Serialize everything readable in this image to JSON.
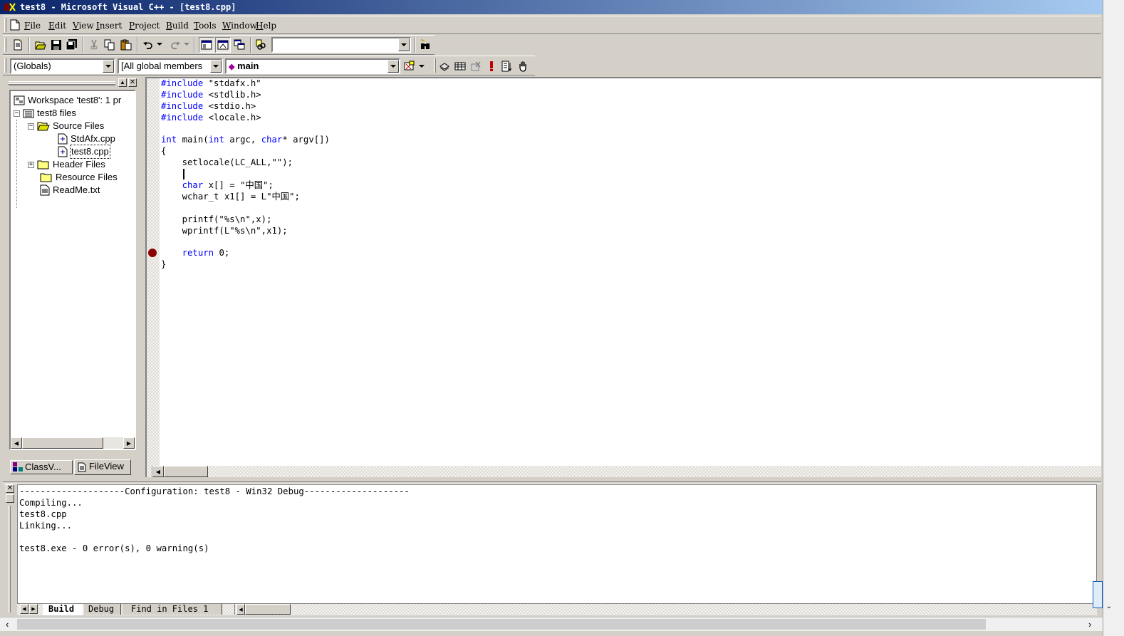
{
  "window": {
    "title": "test8 - Microsoft Visual C++ - [test8.cpp]"
  },
  "menu": {
    "items": [
      {
        "label": "File",
        "mnemonic": "F",
        "rest": "ile"
      },
      {
        "label": "Edit",
        "mnemonic": "E",
        "rest": "dit"
      },
      {
        "label": "View",
        "mnemonic": "V",
        "rest": "iew"
      },
      {
        "label": "Insert",
        "mnemonic": "I",
        "rest": "nsert"
      },
      {
        "label": "Project",
        "mnemonic": "P",
        "rest": "roject"
      },
      {
        "label": "Build",
        "mnemonic": "B",
        "rest": "uild"
      },
      {
        "label": "Tools",
        "mnemonic": "T",
        "rest": "ools"
      },
      {
        "label": "Window",
        "mnemonic": "W",
        "rest": "indow"
      },
      {
        "label": "Help",
        "mnemonic": "H",
        "rest": "elp"
      }
    ]
  },
  "toolbar": {
    "find_combo_value": ""
  },
  "wizardbar": {
    "class_combo": "(Globals)",
    "filter_combo": "[All global members",
    "members_combo": "main"
  },
  "workspace": {
    "tree": [
      {
        "label": "Workspace 'test8': 1 pr",
        "icon": "workspace-icon"
      },
      {
        "label": "test8 files",
        "icon": "project-icon"
      },
      {
        "label": "Source Files",
        "icon": "folder-open-icon"
      },
      {
        "label": "StdAfx.cpp",
        "icon": "cpp-file-icon"
      },
      {
        "label": "test8.cpp",
        "icon": "cpp-file-icon"
      },
      {
        "label": "Header Files",
        "icon": "folder-icon"
      },
      {
        "label": "Resource Files",
        "icon": "folder-icon"
      },
      {
        "label": "ReadMe.txt",
        "icon": "text-file-icon"
      }
    ],
    "tabs": {
      "classview": "ClassV...",
      "fileview": "FileView"
    }
  },
  "editor": {
    "lines": [
      "#include \"stdafx.h\"",
      "#include <stdlib.h>",
      "#include <stdio.h>",
      "#include <locale.h>",
      "",
      "int main(int argc, char* argv[])",
      "{",
      "    setlocale(LC_ALL,\"\");",
      "    ",
      "    char x[] = \"中国\";",
      "    wchar_t x1[] = L\"中国\";",
      "",
      "    printf(\"%s\\n\",x);",
      "    wprintf(L\"%s\\n\",x1);",
      "",
      "    return 0;",
      "}"
    ],
    "breakpoint_line": 16
  },
  "output": {
    "lines": [
      "--------------------Configuration: test8 - Win32 Debug--------------------",
      "Compiling...",
      "test8.cpp",
      "Linking...",
      "",
      "test8.exe - 0 error(s), 0 warning(s)"
    ],
    "tabs": [
      "Build",
      "Debug",
      "Find in Files 1"
    ]
  },
  "colors": {
    "keyword": "#0000ff",
    "breakpoint": "#8b0000",
    "titlebar_start": "#0a246a",
    "titlebar_end": "#a6caf0"
  }
}
